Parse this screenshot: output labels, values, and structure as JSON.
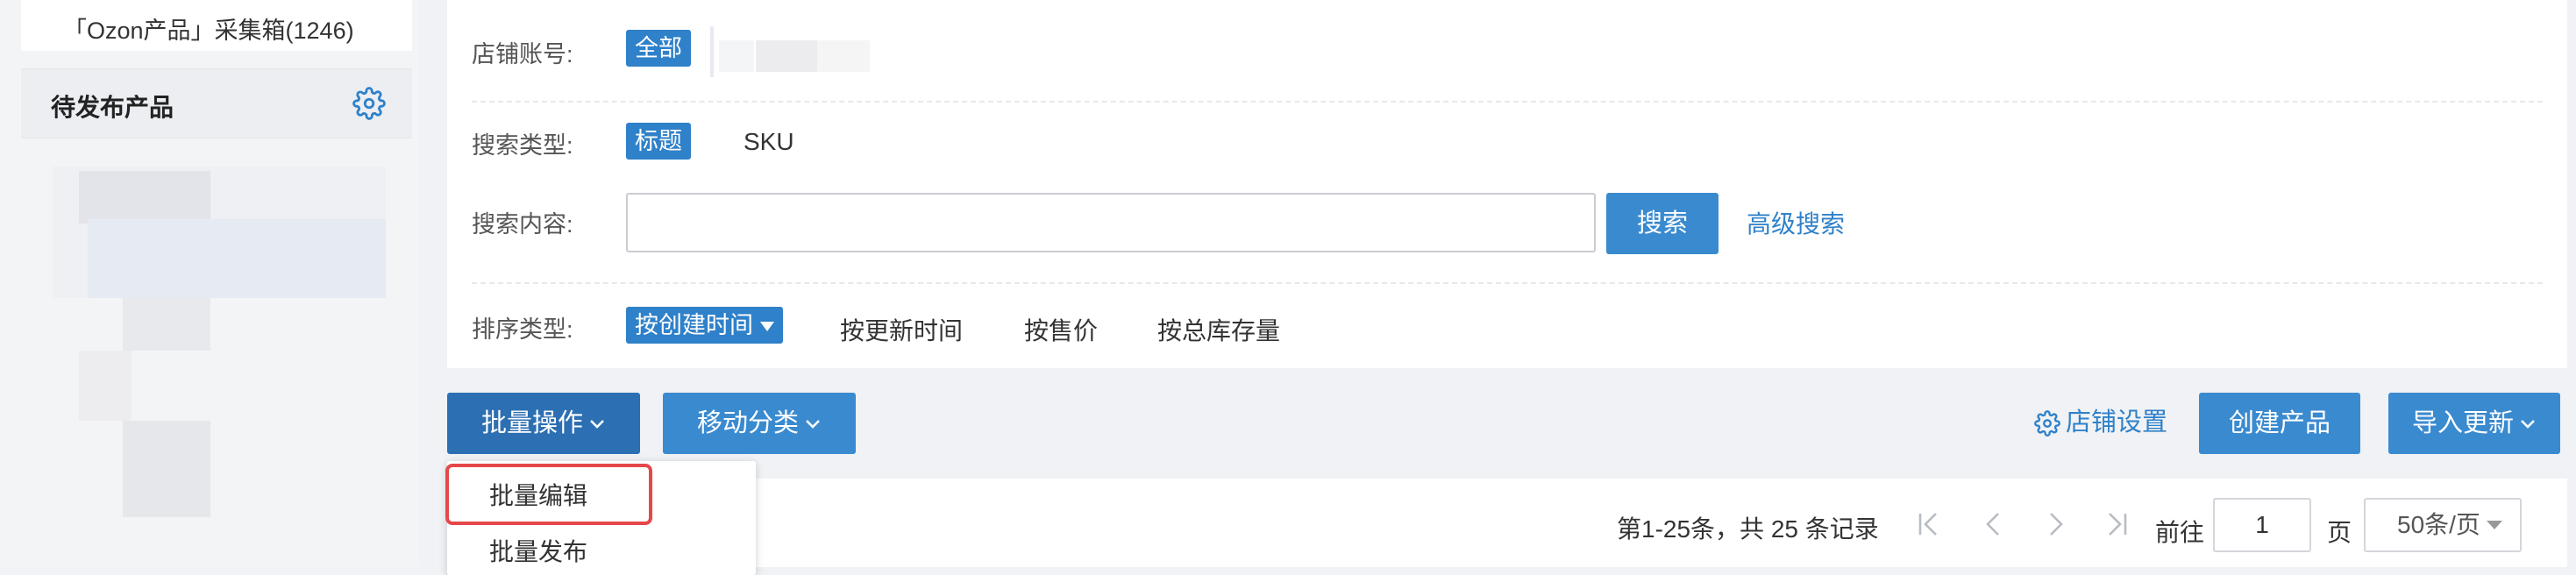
{
  "sidebar": {
    "items": [
      {
        "label": "「Ozon产品」采集箱(1246)"
      },
      {
        "label": "待发布产品",
        "icon": "gear-icon"
      }
    ]
  },
  "filters": {
    "shop_account": {
      "label": "店铺账号:",
      "selected": "全部"
    },
    "search_type": {
      "label": "搜索类型:",
      "options": [
        "标题",
        "SKU"
      ],
      "selected": "标题"
    },
    "search_content": {
      "label": "搜索内容:",
      "value": "",
      "button": "搜索",
      "advanced": "高级搜索"
    },
    "sort_type": {
      "label": "排序类型:",
      "options": [
        "按创建时间",
        "按更新时间",
        "按售价",
        "按总库存量"
      ],
      "selected": "按创建时间"
    }
  },
  "toolbar": {
    "batch_ops": "批量操作",
    "move_category": "移动分类",
    "shop_settings": "店铺设置",
    "create_product": "创建产品",
    "import_update": "导入更新"
  },
  "batch_menu": {
    "items": [
      "批量编辑",
      "批量发布"
    ],
    "highlighted": "批量编辑"
  },
  "pagination": {
    "summary": "第1-25条，共 25 条记录",
    "goto_label": "前往",
    "page": "1",
    "page_unit": "页",
    "page_size": "50条/页"
  },
  "colors": {
    "primary": "#3a8ad0",
    "primary_dark": "#2c6fb3",
    "link": "#2f81c9",
    "highlight": "#e5474b"
  }
}
